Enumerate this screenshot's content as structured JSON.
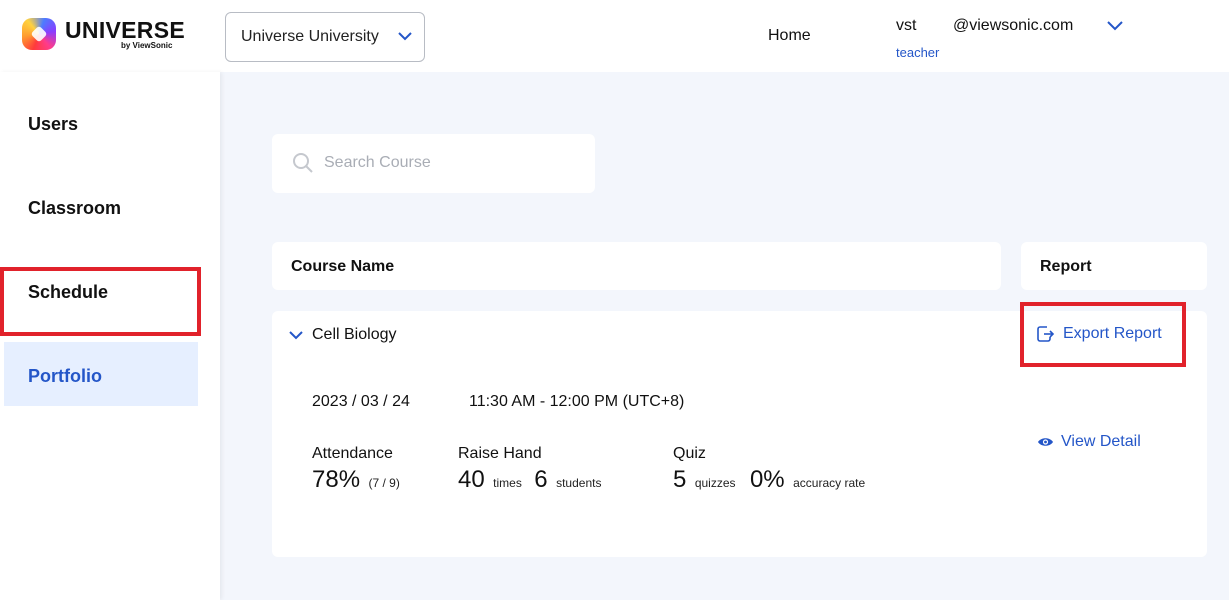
{
  "brand": {
    "name": "UNIVERSE",
    "byline": "by ViewSonic"
  },
  "header": {
    "school": "Universe University",
    "home_link": "Home",
    "user_name": "vst",
    "user_email": "@viewsonic.com",
    "user_role": "teacher"
  },
  "sidebar": {
    "items": [
      {
        "label": "Users"
      },
      {
        "label": "Classroom"
      },
      {
        "label": "Schedule"
      },
      {
        "label": "Portfolio",
        "active": true
      }
    ]
  },
  "search": {
    "placeholder": "Search Course",
    "value": ""
  },
  "table": {
    "columns": [
      "Course Name",
      "Report"
    ],
    "rows": [
      {
        "course": "Cell Biology",
        "date": "2023 / 03 / 24",
        "time": "11:30 AM - 12:00 PM (UTC+8)",
        "attendance_label": "Attendance",
        "attendance_pct": "78%",
        "attendance_count": "(7 / 9)",
        "raise_hand_label": "Raise Hand",
        "raise_hand_times": "40",
        "times_unit": "times",
        "raise_hand_students": "6",
        "students_unit": "students",
        "quiz_label": "Quiz",
        "quiz_count": "5",
        "quizzes_unit": "quizzes",
        "quiz_accuracy": "0%",
        "accuracy_unit": "accuracy rate",
        "export_label": "Export Report",
        "view_label": "View Detail"
      }
    ]
  },
  "colors": {
    "accent": "#2456c8",
    "highlight": "#e1222b",
    "background": "#f3f6fc",
    "active_bg": "#e6efff"
  },
  "icons": [
    "chevron-down-icon",
    "search-icon",
    "export-icon",
    "eye-icon"
  ]
}
